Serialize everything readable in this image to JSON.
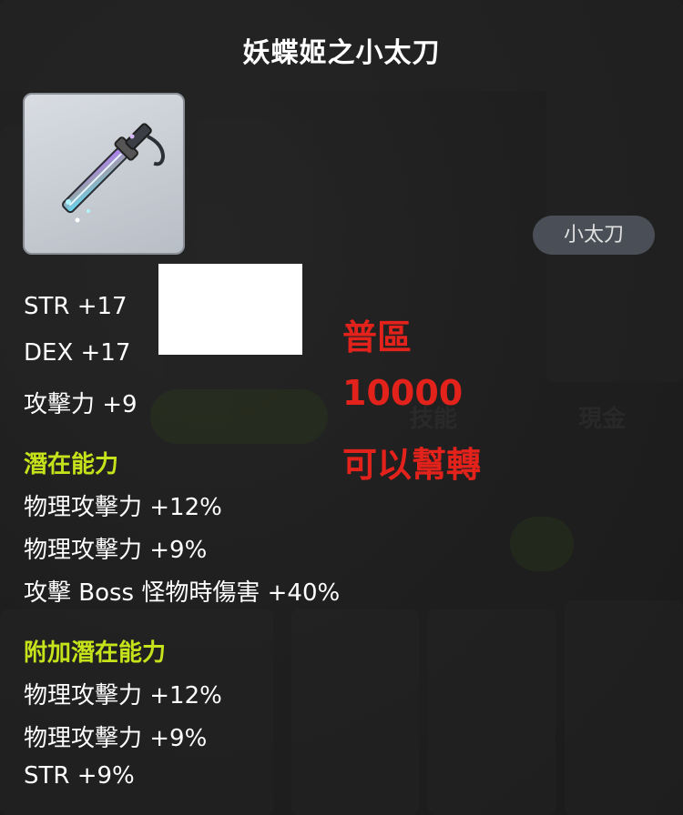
{
  "item": {
    "name": "妖蝶姬之小太刀",
    "type_badge": "小太刀",
    "base_stats": [
      "STR +17",
      "DEX +17",
      "攻擊力 +9"
    ],
    "potential": {
      "label": "潛在能力",
      "lines": [
        "物理攻擊力 +12%",
        "物理攻擊力 +9%",
        "攻擊 Boss 怪物時傷害 +40%"
      ]
    },
    "bonus_potential": {
      "label": "附加潛在能力",
      "lines": [
        "物理攻擊力 +12%",
        "物理攻擊力 +9%",
        "STR +9%"
      ]
    }
  },
  "annotation": {
    "server": "普區",
    "price": "10000",
    "note": "可以幫轉"
  },
  "colors": {
    "section_label": "#c6e21a",
    "annotation": "#e3221c",
    "text": "#ffffff"
  },
  "icons": [
    "sword-icon"
  ]
}
